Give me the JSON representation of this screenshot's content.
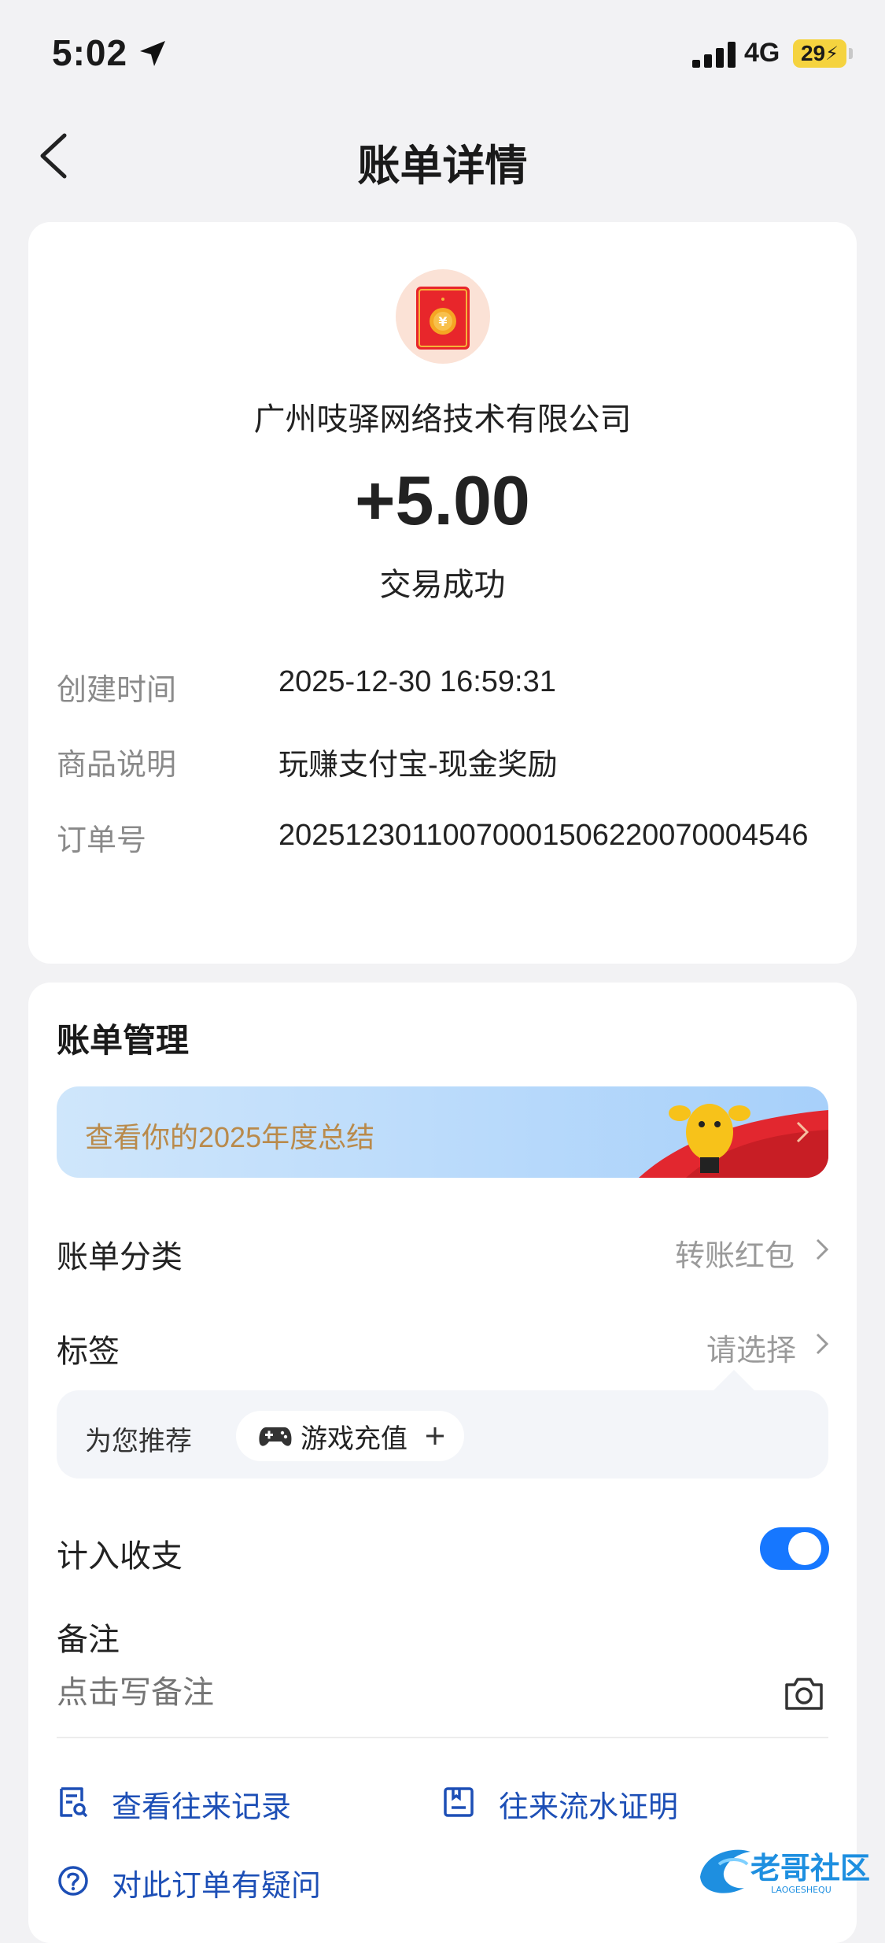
{
  "status_bar": {
    "time": "5:02",
    "network": "4G",
    "battery": "29"
  },
  "nav": {
    "title": "账单详情"
  },
  "transaction": {
    "merchant": "广州吱驿网络技术有限公司",
    "amount": "+5.00",
    "status": "交易成功",
    "details": [
      {
        "label": "创建时间",
        "value": "2025-12-30 16:59:31"
      },
      {
        "label": "商品说明",
        "value": "玩赚支付宝-现金奖励"
      },
      {
        "label": "订单号",
        "value": "20251230110070001506220070004546"
      }
    ]
  },
  "management": {
    "title": "账单管理",
    "banner_text": "查看你的2025年度总结",
    "category_label": "账单分类",
    "category_value": "转账红包",
    "tag_label": "标签",
    "tag_value": "请选择",
    "recommend_label": "为您推荐",
    "recommend_chip": "游戏充值",
    "include_label": "计入收支",
    "include_on": true,
    "note_label": "备注",
    "note_placeholder": "点击写备注"
  },
  "links": {
    "records": "查看往来记录",
    "proof": "往来流水证明",
    "question": "对此订单有疑问"
  },
  "watermark": {
    "text": "老哥社区",
    "sub": "LAOGESHEQU"
  },
  "colors": {
    "accent": "#1677ff",
    "link": "#1d4fb6",
    "banner_text": "#b98a4b"
  }
}
